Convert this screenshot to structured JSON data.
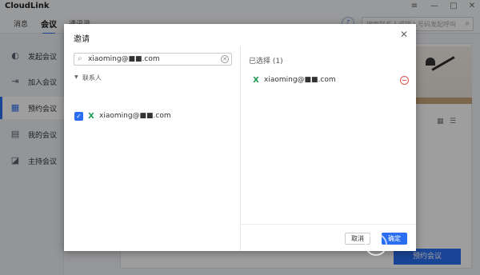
{
  "app": {
    "title": "CloudLink"
  },
  "topnav": {
    "tabs": [
      "消息",
      "会议",
      "通讯录"
    ],
    "active": "会议"
  },
  "search": {
    "placeholder": "搜索联系人或输入号码发起呼叫"
  },
  "sidebar": {
    "items": [
      {
        "label": "发起会议",
        "icon": "video-icon"
      },
      {
        "label": "加入会议",
        "icon": "join-icon"
      },
      {
        "label": "预约会议",
        "icon": "calendar-icon",
        "active": true
      },
      {
        "label": "我的会议",
        "icon": "calendar-list-icon"
      },
      {
        "label": "主持会议",
        "icon": "host-icon"
      }
    ]
  },
  "background": {
    "book_button": "预约会议"
  },
  "dialog": {
    "title": "邀请",
    "search_value": "xiaoming@■■.com",
    "group_label": "联系人",
    "contacts": [
      {
        "name": "xiaoming@■■.com",
        "checked": true
      }
    ],
    "selected_title": "已选择 (1)",
    "selected": [
      {
        "name": "xiaoming@■■.com"
      }
    ],
    "cancel": "取消",
    "ok": "确定"
  },
  "colors": {
    "accent": "#2b6ef2",
    "remove": "#e2574c",
    "excel": "#1f9d55"
  }
}
